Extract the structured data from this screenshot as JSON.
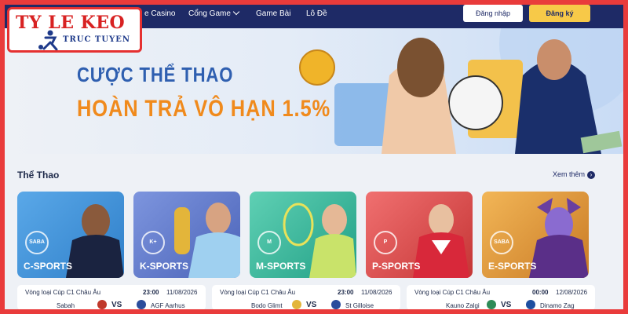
{
  "nav": {
    "casino": "e Casino",
    "game_portal": "Cổng Game",
    "card_games": "Game Bài",
    "lottery": "Lô Đề",
    "login": "Đăng nhập",
    "register": "Đăng ký"
  },
  "logo": {
    "line1": "TY LE KEO",
    "line2": "TRUC TUYEN"
  },
  "banner": {
    "line1": "CƯỢC THỂ THAO",
    "line2": "HOÀN TRẢ VÔ HẠN 1.5%"
  },
  "sports": {
    "title": "Thể Thao",
    "more": "Xem thêm",
    "cards": [
      {
        "label": "C-SPORTS",
        "badge": "SABA",
        "color": "#3b8fd8"
      },
      {
        "label": "K-SPORTS",
        "badge": "K+",
        "color": "#5b78c9"
      },
      {
        "label": "M-SPORTS",
        "badge": "M",
        "color": "#2fb39a"
      },
      {
        "label": "P-SPORTS",
        "badge": "P",
        "color": "#d9484a"
      },
      {
        "label": "E-SPORTS",
        "badge": "SABA",
        "color": "#e09a3a"
      }
    ]
  },
  "matches": [
    {
      "league": "Vòng loại Cúp C1 Châu Âu",
      "time": "23:00",
      "date": "11/08/2026",
      "team1": "Sabah",
      "vs": "VS",
      "team2": "AGF Aarhus"
    },
    {
      "league": "Vòng loại Cúp C1 Châu Âu",
      "time": "23:00",
      "date": "11/08/2026",
      "team1": "Bodo Glimt",
      "vs": "VS",
      "team2": "St Gilloise"
    },
    {
      "league": "Vòng loại Cúp C1 Châu Âu",
      "time": "00:00",
      "date": "12/08/2026",
      "team1": "Kauno Zalgi",
      "vs": "VS",
      "team2": "Dinamo Zag"
    }
  ]
}
